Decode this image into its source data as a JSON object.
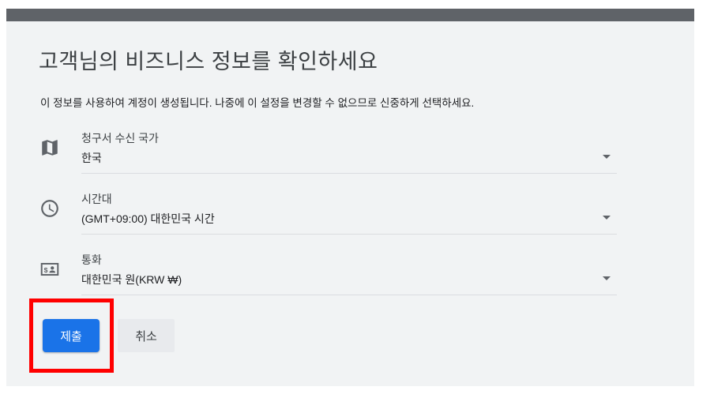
{
  "page": {
    "title": "고객님의 비즈니스 정보를 확인하세요",
    "description": "이 정보를 사용하여 계정이 생성됩니다. 나중에 이 설정을 변경할 수 없으므로 신중하게 선택하세요."
  },
  "fields": [
    {
      "label": "청구서 수신 국가",
      "value": "한국",
      "icon": "map-icon"
    },
    {
      "label": "시간대",
      "value": "(GMT+09:00) 대한민국 시간",
      "icon": "clock-icon"
    },
    {
      "label": "통화",
      "value": "대한민국 원(KRW ₩)",
      "icon": "currency-icon"
    }
  ],
  "actions": {
    "submit_label": "제출",
    "cancel_label": "취소"
  },
  "colors": {
    "accent": "#1a73e8",
    "highlight": "#ff0000"
  }
}
